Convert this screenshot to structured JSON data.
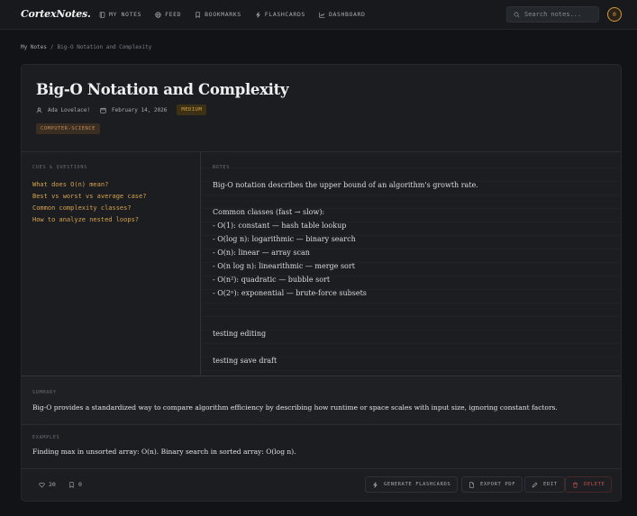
{
  "app": {
    "logo": "CortexNotes."
  },
  "nav": {
    "items": [
      {
        "label": "MY NOTES",
        "icon": "notebook-icon"
      },
      {
        "label": "FEED",
        "icon": "globe-icon"
      },
      {
        "label": "BOOKMARKS",
        "icon": "bookmark-icon"
      },
      {
        "label": "FLASHCARDS",
        "icon": "bolt-icon"
      },
      {
        "label": "DASHBOARD",
        "icon": "chart-icon"
      }
    ],
    "search_placeholder": "Search notes...",
    "avatar_initial": "0"
  },
  "breadcrumb": {
    "root": "My Notes",
    "separator": "/",
    "current": "Big-O Notation and Complexity"
  },
  "note": {
    "title": "Big-O Notation and Complexity",
    "author": "Ada Lovelace!",
    "date": "February 14, 2026",
    "difficulty": "MEDIUM",
    "tag": "COMPUTER-SCIENCE",
    "cues_label": "CUES & QUESTIONS",
    "cues": [
      "What does O(n) mean?",
      "Best vs worst vs average case?",
      "Common complexity classes?",
      "How to analyze nested loops?"
    ],
    "notes_label": "NOTES",
    "note_lines": [
      "Big-O notation describes the upper bound of an algorithm's growth rate.",
      "",
      "Common classes (fast → slow):",
      "- O(1): constant — hash table lookup",
      "- O(log n): logarithmic — binary search",
      "- O(n): linear — array scan",
      "- O(n log n): linearithmic — merge sort",
      "- O(n²): quadratic — bubble sort",
      "- O(2ⁿ): exponential — brute-force subsets",
      "",
      "",
      "testing editing",
      "",
      "testing save draft"
    ],
    "summary_label": "SUMMARY",
    "summary": "Big-O provides a standardized way to compare algorithm efficiency by describing how runtime or space scales with input size, ignoring constant factors.",
    "examples_label": "EXAMPLES",
    "examples": "Finding max in unsorted array: O(n). Binary search in sorted array: O(log n)."
  },
  "footer": {
    "likes": "20",
    "bookmarks": "0",
    "generate_flashcards": "GENERATE FLASHCARDS",
    "export_pdf": "EXPORT PDF",
    "edit": "EDIT",
    "delete": "DELETE"
  },
  "colors": {
    "accent": "#d6a24e",
    "background": "#111317",
    "card": "#1b1d21",
    "danger": "#c94d4d"
  }
}
